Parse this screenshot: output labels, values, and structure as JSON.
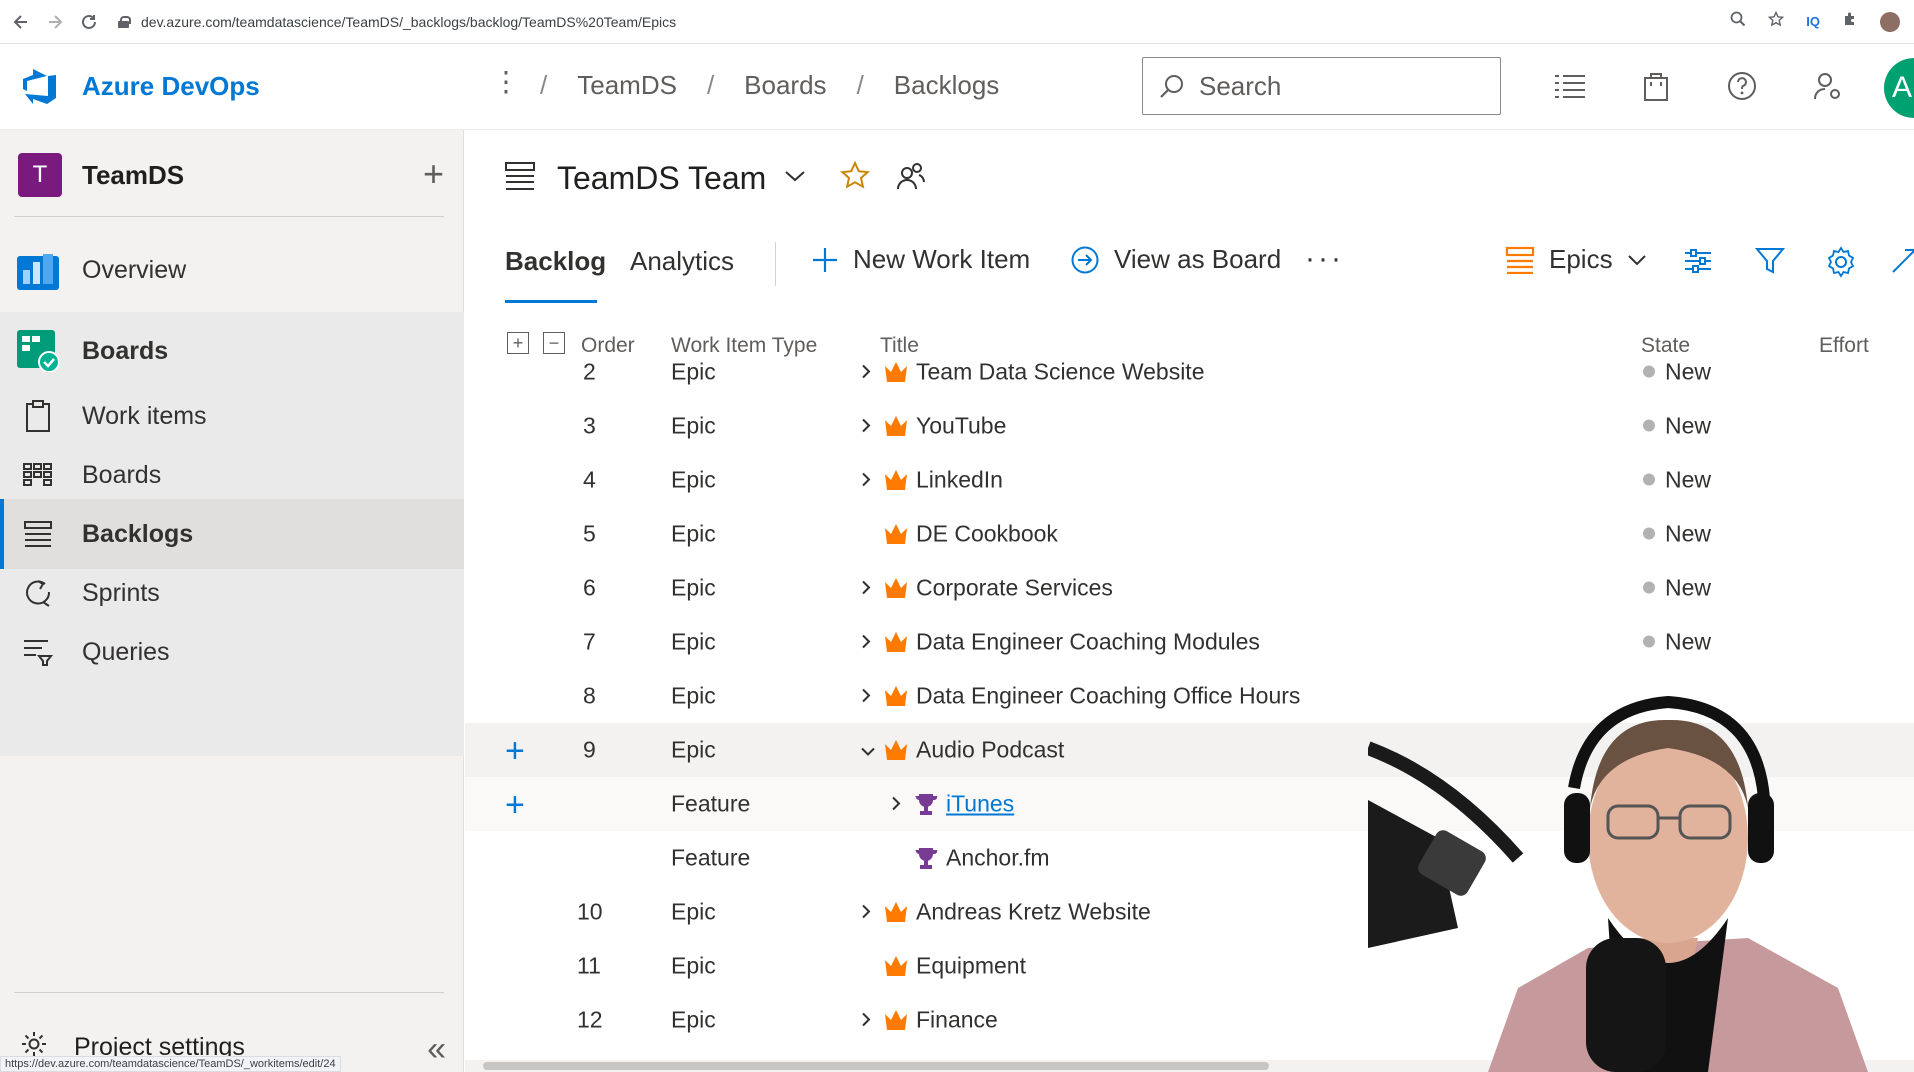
{
  "browser": {
    "url": "dev.azure.com/teamdatascience/TeamDS/_backlogs/backlog/TeamDS%20Team/Epics",
    "status_url": "https://dev.azure.com/teamdatascience/TeamDS/_workitems/edit/24",
    "ext_label": "IQ"
  },
  "header": {
    "brand": "Azure DevOps",
    "breadcrumb": [
      "TeamDS",
      "Boards",
      "Backlogs"
    ],
    "separator": "/",
    "search_placeholder": "Search",
    "avatar_initial": "A",
    "accent": "#0078d4"
  },
  "sidebar": {
    "project_initial": "T",
    "project_name": "TeamDS",
    "project_color": "#7a1a7f",
    "items": [
      {
        "label": "Overview",
        "icon": "overview-icon"
      },
      {
        "label": "Boards",
        "icon": "boards-hub-icon"
      },
      {
        "label": "Work items",
        "icon": "work-items-icon"
      },
      {
        "label": "Boards",
        "icon": "kanban-board-icon"
      },
      {
        "label": "Backlogs",
        "icon": "backlog-icon"
      },
      {
        "label": "Sprints",
        "icon": "sprint-icon"
      },
      {
        "label": "Queries",
        "icon": "query-icon"
      }
    ],
    "settings_label": "Project settings"
  },
  "main": {
    "team_name": "TeamDS Team",
    "tabs": [
      "Backlog",
      "Analytics"
    ],
    "new_work_item": "New Work Item",
    "view_as_board": "View as Board",
    "more": "···",
    "level": "Epics",
    "columns": {
      "order": "Order",
      "type": "Work Item Type",
      "title": "Title",
      "state": "State",
      "effort": "Effort"
    },
    "rows": [
      {
        "order": "2",
        "type": "Epic",
        "title": "Team Data Science Website",
        "state": "New",
        "kind": "epic",
        "chevron": "right",
        "indent": 0
      },
      {
        "order": "3",
        "type": "Epic",
        "title": "YouTube",
        "state": "New",
        "kind": "epic",
        "chevron": "right",
        "indent": 0
      },
      {
        "order": "4",
        "type": "Epic",
        "title": "LinkedIn",
        "state": "New",
        "kind": "epic",
        "chevron": "right",
        "indent": 0
      },
      {
        "order": "5",
        "type": "Epic",
        "title": "DE Cookbook",
        "state": "New",
        "kind": "epic",
        "chevron": "",
        "indent": 0
      },
      {
        "order": "6",
        "type": "Epic",
        "title": "Corporate Services",
        "state": "New",
        "kind": "epic",
        "chevron": "right",
        "indent": 0
      },
      {
        "order": "7",
        "type": "Epic",
        "title": "Data Engineer Coaching Modules",
        "state": "New",
        "kind": "epic",
        "chevron": "right",
        "indent": 0
      },
      {
        "order": "8",
        "type": "Epic",
        "title": "Data Engineer Coaching Office Hours",
        "state": "",
        "kind": "epic",
        "chevron": "right",
        "indent": 0
      },
      {
        "order": "9",
        "type": "Epic",
        "title": "Audio Podcast",
        "state": "",
        "kind": "epic",
        "chevron": "down",
        "indent": 0,
        "plus": true,
        "highlight": "hover"
      },
      {
        "order": "",
        "type": "Feature",
        "title": "iTunes",
        "state": "",
        "kind": "feature",
        "chevron": "right",
        "indent": 1,
        "plus": true,
        "highlight": "hover2",
        "link": true
      },
      {
        "order": "",
        "type": "Feature",
        "title": "Anchor.fm",
        "state": "",
        "kind": "feature",
        "chevron": "",
        "indent": 1
      },
      {
        "order": "10",
        "type": "Epic",
        "title": "Andreas Kretz Website",
        "state": "",
        "kind": "epic",
        "chevron": "right",
        "indent": 0
      },
      {
        "order": "11",
        "type": "Epic",
        "title": "Equipment",
        "state": "",
        "kind": "epic",
        "chevron": "",
        "indent": 0
      },
      {
        "order": "12",
        "type": "Epic",
        "title": "Finance",
        "state": "",
        "kind": "epic",
        "chevron": "right",
        "indent": 0
      }
    ],
    "epic_color": "#ff7b00",
    "feature_color": "#773b93",
    "state_new_color": "#b2b2b2"
  }
}
